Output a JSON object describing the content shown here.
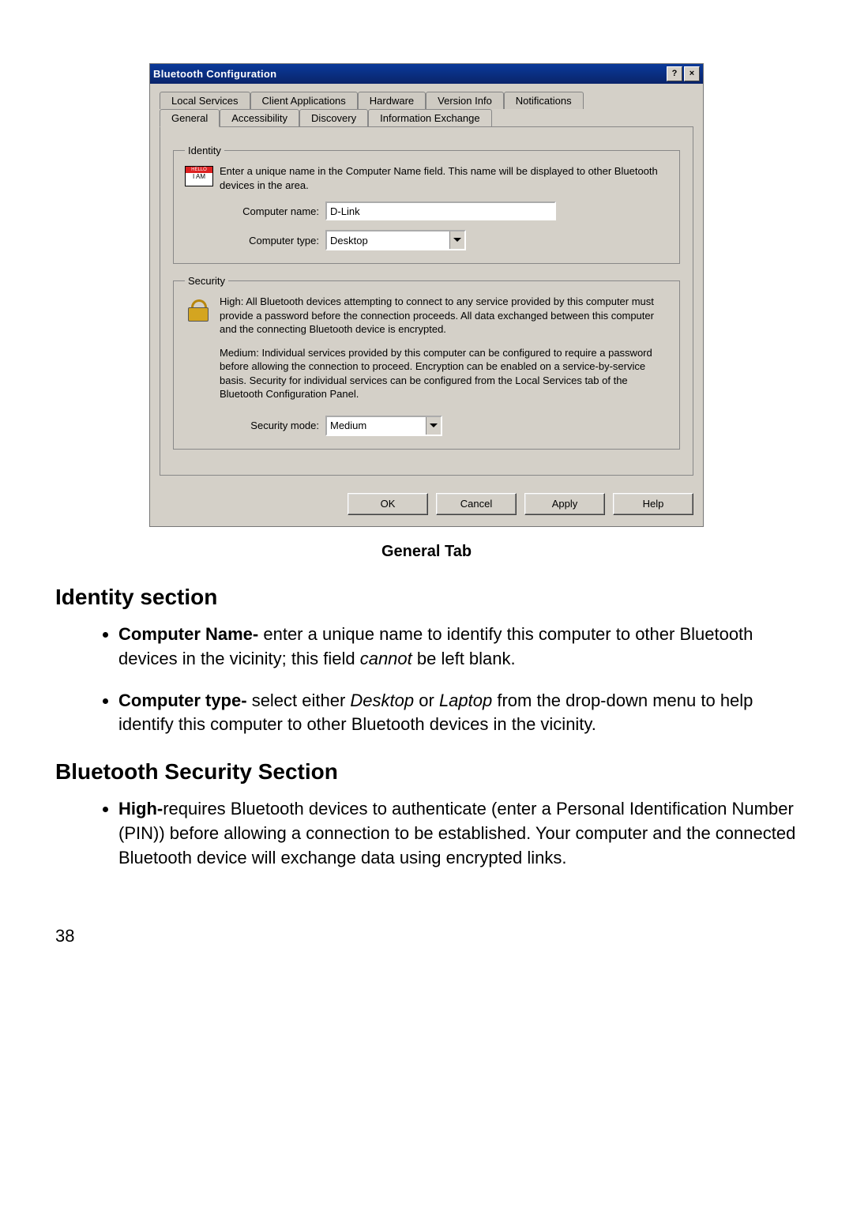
{
  "dialog": {
    "title": "Bluetooth Configuration",
    "help_btn": "?",
    "close_btn": "×",
    "tabs_back": [
      "Local Services",
      "Client Applications",
      "Hardware",
      "Version Info",
      "Notifications"
    ],
    "tabs_front": [
      "General",
      "Accessibility",
      "Discovery",
      "Information Exchange"
    ],
    "identity": {
      "legend": "Identity",
      "nametag_text": "I AM",
      "desc": "Enter a unique name in the Computer Name field. This name will be displayed to other Bluetooth devices in the area.",
      "name_label": "Computer name:",
      "name_value": "D-Link",
      "type_label": "Computer type:",
      "type_value": "Desktop"
    },
    "security": {
      "legend": "Security",
      "desc_high": "High: All Bluetooth devices attempting to connect to any service provided by this computer must provide a password before the connection proceeds. All data exchanged between this computer and the connecting Bluetooth device is encrypted.",
      "desc_medium": "Medium: Individual services provided by this computer can be configured to require a password before allowing the connection to proceed. Encryption can be enabled on a service-by-service basis. Security for individual services can be configured from the Local Services tab of the Bluetooth Configuration Panel.",
      "mode_label": "Security mode:",
      "mode_value": "Medium"
    },
    "buttons": {
      "ok": "OK",
      "cancel": "Cancel",
      "apply": "Apply",
      "help": "Help"
    }
  },
  "doc": {
    "caption": "General Tab",
    "identity_heading": "Identity section",
    "identity_items": [
      {
        "bold": "Computer Name- ",
        "rest_a": "enter a unique name to identify this computer to other Bluetooth devices in the vicinity; this field ",
        "italic": "cannot",
        "rest_b": " be left blank."
      },
      {
        "bold": "Computer type- ",
        "rest_a": "select either ",
        "italic": "Desktop",
        "mid": " or ",
        "italic2": "Laptop",
        "rest_b": " from the drop-down menu to help identify this computer to other Bluetooth devices in the vicinity."
      }
    ],
    "security_heading": "Bluetooth Security Section",
    "security_items": [
      {
        "bold": "High-",
        "rest": "requires Bluetooth devices to authenticate (enter a Personal Identification Number (PIN)) before allowing a connection to be established. Your computer and the connected Bluetooth device will exchange data using encrypted links."
      }
    ],
    "page_number": "38"
  }
}
